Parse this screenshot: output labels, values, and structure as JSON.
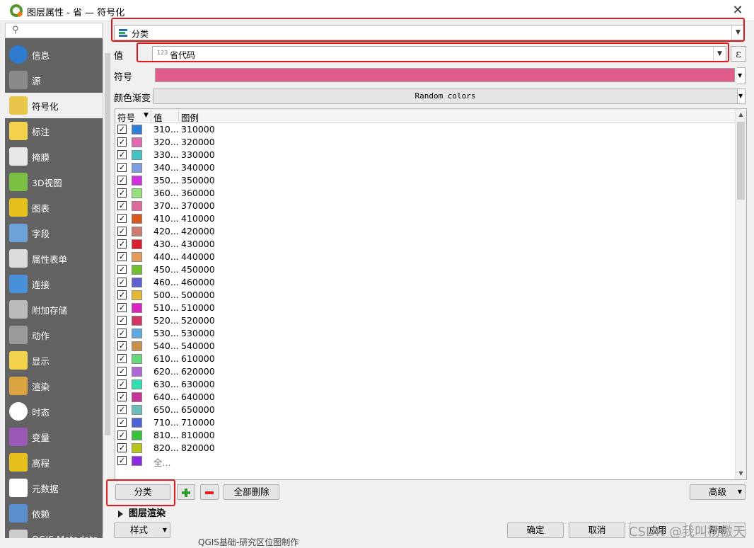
{
  "window": {
    "title": "图层属性 - 省 — 符号化",
    "close_glyph": "✕"
  },
  "sidebar": {
    "search_glyph": "⚲",
    "items": [
      {
        "label": "信息",
        "icon": "info-icon",
        "color": "#2f7bd0"
      },
      {
        "label": "源",
        "icon": "source-wrench-icon",
        "color": "#8a8a8a"
      },
      {
        "label": "符号化",
        "icon": "symbology-brush-icon",
        "color": "#e8c64a"
      },
      {
        "label": "标注",
        "icon": "labels-abc-icon",
        "color": "#f2d24a"
      },
      {
        "label": "掩膜",
        "icon": "mask-abc-icon",
        "color": "#e8e8e8"
      },
      {
        "label": "3D视图",
        "icon": "3d-cube-icon",
        "color": "#7bc043"
      },
      {
        "label": "图表",
        "icon": "diagram-icon",
        "color": "#e6c11d"
      },
      {
        "label": "字段",
        "icon": "fields-icon",
        "color": "#6da2d8"
      },
      {
        "label": "属性表单",
        "icon": "attributes-form-icon",
        "color": "#dcdcdc"
      },
      {
        "label": "连接",
        "icon": "joins-icon",
        "color": "#4a90d9"
      },
      {
        "label": "附加存储",
        "icon": "auxiliary-storage-icon",
        "color": "#bbbbbb"
      },
      {
        "label": "动作",
        "icon": "actions-gear-icon",
        "color": "#9a9a9a"
      },
      {
        "label": "显示",
        "icon": "display-tooltip-icon",
        "color": "#f2d24a"
      },
      {
        "label": "渲染",
        "icon": "rendering-brush-icon",
        "color": "#d9a441"
      },
      {
        "label": "时态",
        "icon": "temporal-clock-icon",
        "color": "#ffffff"
      },
      {
        "label": "变量",
        "icon": "variables-epsilon-icon",
        "color": "#9b59b6"
      },
      {
        "label": "高程",
        "icon": "elevation-icon",
        "color": "#e6c11d"
      },
      {
        "label": "元数据",
        "icon": "metadata-icon",
        "color": "#ffffff"
      },
      {
        "label": "依赖",
        "icon": "dependencies-icon",
        "color": "#5a8fd0"
      },
      {
        "label": "QGIS Metadata",
        "icon": "qgis-metadata-icon",
        "color": "#cccccc"
      }
    ]
  },
  "symbology": {
    "renderer": "分类",
    "value_label": "值",
    "value_field_type": "123",
    "value_field": "省代码",
    "expression_glyph": "ε",
    "symbol_label": "符号",
    "symbol_color": "#e05c8c",
    "ramp_label": "颜色渐变",
    "ramp_value": "Random colors"
  },
  "table": {
    "headers": {
      "symbol": "符号",
      "value": "值",
      "legend": "图例"
    },
    "rows": [
      {
        "value": "310...",
        "legend": "310000",
        "color": "#2e7fdc"
      },
      {
        "value": "320...",
        "legend": "320000",
        "color": "#e06ab0"
      },
      {
        "value": "330...",
        "legend": "330000",
        "color": "#45c4c8"
      },
      {
        "value": "340...",
        "legend": "340000",
        "color": "#7f9be0"
      },
      {
        "value": "350...",
        "legend": "350000",
        "color": "#d32de0"
      },
      {
        "value": "360...",
        "legend": "360000",
        "color": "#96e07a"
      },
      {
        "value": "370...",
        "legend": "370000",
        "color": "#dd6a98"
      },
      {
        "value": "410...",
        "legend": "410000",
        "color": "#d9571e"
      },
      {
        "value": "420...",
        "legend": "420000",
        "color": "#cc7b6e"
      },
      {
        "value": "430...",
        "legend": "430000",
        "color": "#dc1f2f"
      },
      {
        "value": "440...",
        "legend": "440000",
        "color": "#e39a5a"
      },
      {
        "value": "450...",
        "legend": "450000",
        "color": "#72bf2e"
      },
      {
        "value": "460...",
        "legend": "460000",
        "color": "#5f5fd2"
      },
      {
        "value": "500...",
        "legend": "500000",
        "color": "#e3b832"
      },
      {
        "value": "510...",
        "legend": "510000",
        "color": "#dd22c2"
      },
      {
        "value": "520...",
        "legend": "520000",
        "color": "#d23561"
      },
      {
        "value": "530...",
        "legend": "530000",
        "color": "#5ea9df"
      },
      {
        "value": "540...",
        "legend": "540000",
        "color": "#c8904a"
      },
      {
        "value": "610...",
        "legend": "610000",
        "color": "#63d97a"
      },
      {
        "value": "620...",
        "legend": "620000",
        "color": "#b068d8"
      },
      {
        "value": "630...",
        "legend": "630000",
        "color": "#2fe0b0"
      },
      {
        "value": "640...",
        "legend": "640000",
        "color": "#c83299"
      },
      {
        "value": "650...",
        "legend": "650000",
        "color": "#6ac0b8"
      },
      {
        "value": "710...",
        "legend": "710000",
        "color": "#4a64d6"
      },
      {
        "value": "810...",
        "legend": "810000",
        "color": "#38c43a"
      },
      {
        "value": "820...",
        "legend": "820000",
        "color": "#b8c41a"
      },
      {
        "value": "全...",
        "legend": "",
        "color": "#8a2be2"
      }
    ]
  },
  "buttons": {
    "classify": "分类",
    "delete_all": "全部删除",
    "advanced": "高级",
    "style": "样式",
    "ok": "确定",
    "cancel": "取消",
    "apply": "应用",
    "help": "帮助"
  },
  "layer_rendering_label": "图层渲染",
  "background_text": "QGIS基础-研究区位图制作",
  "watermark": "CSDN @我叫杨傲天"
}
